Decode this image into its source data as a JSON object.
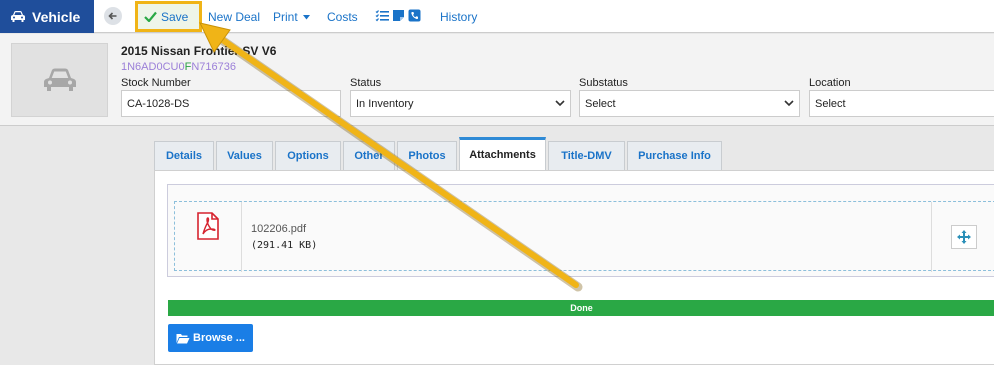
{
  "app": {
    "title": "Vehicle"
  },
  "toolbar": {
    "save_label": "Save",
    "new_deal_label": "New Deal",
    "print_label": "Print",
    "costs_label": "Costs",
    "history_label": "History"
  },
  "vehicle": {
    "title": "2015 Nissan Frontier SV V6",
    "vin_part1": "1N6AD0CU0",
    "vin_part2": "F",
    "vin_part3": "N716736"
  },
  "fields": {
    "stock_number": {
      "label": "Stock Number",
      "value": "CA-1028-DS"
    },
    "status": {
      "label": "Status",
      "value": "In Inventory"
    },
    "substatus": {
      "label": "Substatus",
      "value": "Select"
    },
    "location": {
      "label": "Location",
      "value": "Select"
    }
  },
  "tabs": [
    {
      "label": "Details"
    },
    {
      "label": "Values"
    },
    {
      "label": "Options"
    },
    {
      "label": "Other"
    },
    {
      "label": "Photos"
    },
    {
      "label": "Attachments"
    },
    {
      "label": "Title-DMV"
    },
    {
      "label": "Purchase Info"
    }
  ],
  "attachment": {
    "file_name": "102206.pdf",
    "file_size": "(291.41 KB)"
  },
  "upload": {
    "status": "Done",
    "progress": 1.0,
    "browse_label": "Browse ..."
  },
  "colors": {
    "brand": "#1f4e9b",
    "link": "#1a73c8",
    "highlight": "#f0b417",
    "progress": "#2aa845",
    "button": "#1a7ee6"
  }
}
